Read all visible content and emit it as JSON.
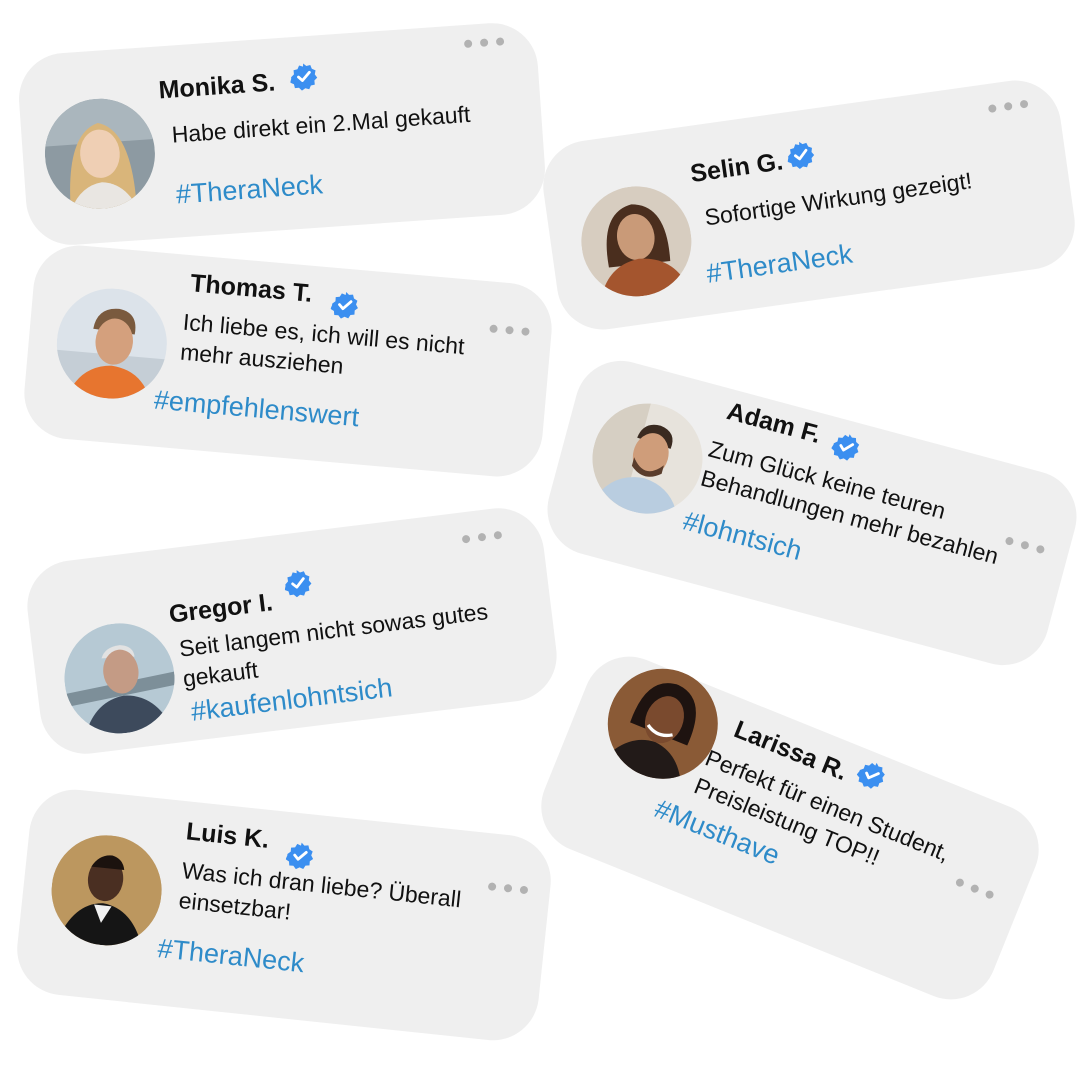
{
  "reviews": [
    {
      "name": "Monika S.",
      "text": "Habe direkt ein 2.Mal gekauft",
      "tag": "#TheraNeck",
      "avatar": "woman-blonde-avatar"
    },
    {
      "name": "Selin G.",
      "text": "Sofortige Wirkung gezeigt!",
      "tag": "#TheraNeck",
      "avatar": "woman-curly-avatar"
    },
    {
      "name": "Thomas T.",
      "text": "Ich liebe es, ich will es nicht mehr ausziehen",
      "tag": "#empfehlenswert",
      "avatar": "man-grey-hair-avatar"
    },
    {
      "name": "Adam F.",
      "text": "Zum Glück keine teuren Behandlungen mehr bezahlen",
      "tag": "#lohntsich",
      "avatar": "man-beard-avatar"
    },
    {
      "name": "Gregor I.",
      "text": "Seit langem nicht sowas gutes gekauft",
      "tag": "#kaufenlohntsich",
      "avatar": "old-man-avatar"
    },
    {
      "name": "Larissa R.",
      "text": "Perfekt für einen Student, Preisleistung TOP!!",
      "tag": "#Musthave",
      "avatar": "woman-dark-hair-avatar"
    },
    {
      "name": "Luis K.",
      "text": "Was ich dran liebe? Überall einsetzbar!",
      "tag": "#TheraNeck",
      "avatar": "man-dark-jacket-avatar"
    }
  ],
  "colors": {
    "card": "#efefef",
    "hashtag": "#2e8bc9",
    "verified": "#3b8ff0",
    "dots": "#b2b2b2"
  },
  "icons": {
    "verified": "verified-badge-icon",
    "menu": "more-dots-icon"
  }
}
